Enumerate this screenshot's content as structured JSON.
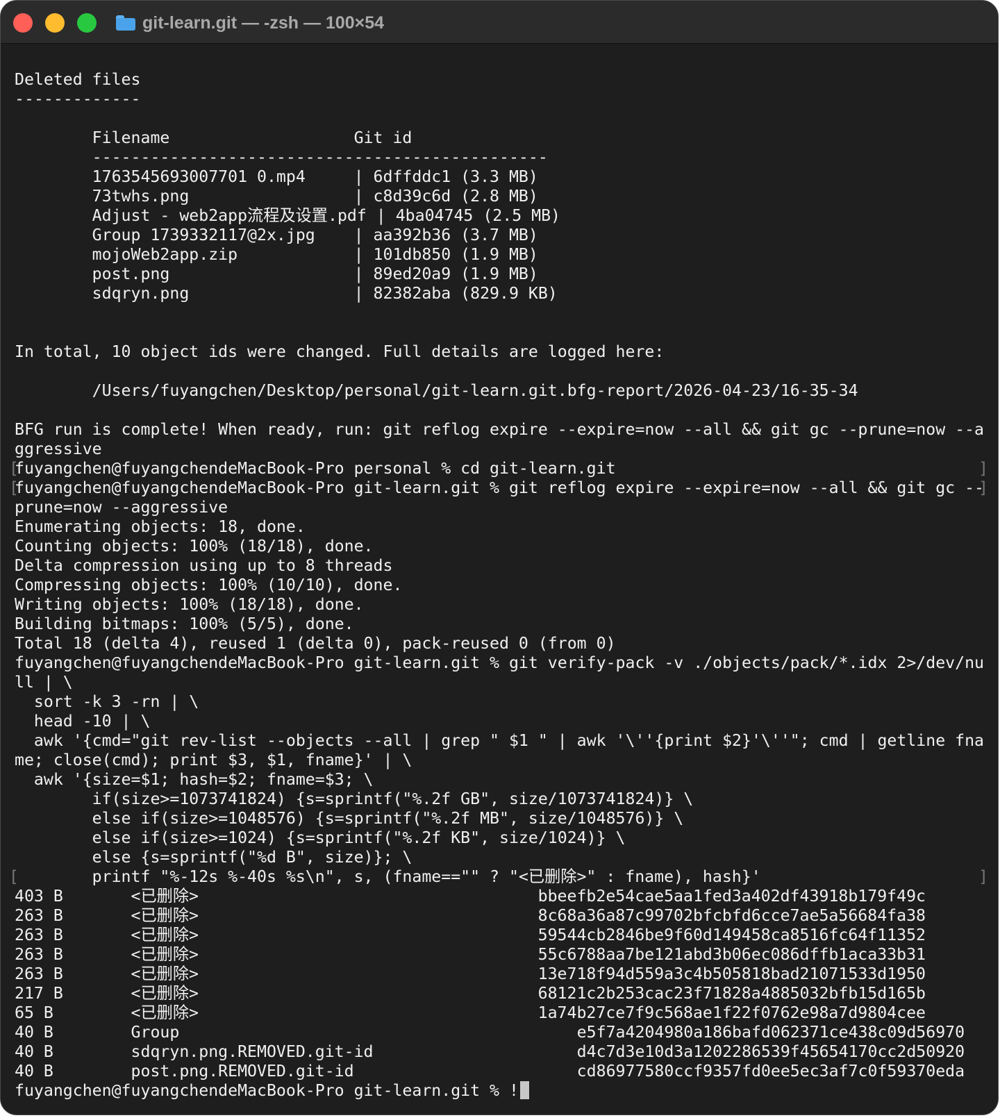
{
  "window": {
    "title": "git-learn.git — -zsh — 100×54",
    "folder_icon": "folder-icon",
    "colors": {
      "close": "#ff5f57",
      "minimize": "#febc2e",
      "maximize": "#28c840",
      "background": "#1e1e1e",
      "text": "#f0f0f0"
    }
  },
  "terminal": {
    "lines": [
      {
        "text": "Deleted files"
      },
      {
        "text": "-------------"
      },
      {
        "text": ""
      },
      {
        "text": "        Filename                   Git id"
      },
      {
        "text": "        -----------------------------------------------"
      },
      {
        "text": "        1763545693007701 0.mp4     | 6dffddc1 (3.3 MB)"
      },
      {
        "text": "        73twhs.png                 | c8d39c6d (2.8 MB)"
      },
      {
        "text": "        Adjust - web2app流程及设置.pdf | 4ba04745 (2.5 MB)"
      },
      {
        "text": "        Group 1739332117@2x.jpg    | aa392b36 (3.7 MB)"
      },
      {
        "text": "        mojoWeb2app.zip            | 101db850 (1.9 MB)"
      },
      {
        "text": "        post.png                   | 89ed20a9 (1.9 MB)"
      },
      {
        "text": "        sdqryn.png                 | 82382aba (829.9 KB)"
      },
      {
        "text": ""
      },
      {
        "text": ""
      },
      {
        "text": "In total, 10 object ids were changed. Full details are logged here:"
      },
      {
        "text": ""
      },
      {
        "text": "        /Users/fuyangchen/Desktop/personal/git-learn.git.bfg-report/2026-04-23/16-35-34"
      },
      {
        "text": ""
      },
      {
        "text": "BFG run is complete! When ready, run: git reflog expire --expire=now --all && git gc --prune=now --a"
      },
      {
        "text": "ggressive"
      },
      {
        "text": "fuyangchen@fuyangchendeMacBook-Pro personal % cd git-learn.git",
        "bracket": true
      },
      {
        "text": "fuyangchen@fuyangchendeMacBook-Pro git-learn.git % git reflog expire --expire=now --all && git gc --",
        "bracket": true
      },
      {
        "text": "prune=now --aggressive"
      },
      {
        "text": "Enumerating objects: 18, done."
      },
      {
        "text": "Counting objects: 100% (18/18), done."
      },
      {
        "text": "Delta compression using up to 8 threads"
      },
      {
        "text": "Compressing objects: 100% (10/10), done."
      },
      {
        "text": "Writing objects: 100% (18/18), done."
      },
      {
        "text": "Building bitmaps: 100% (5/5), done."
      },
      {
        "text": "Total 18 (delta 4), reused 1 (delta 0), pack-reused 0 (from 0)"
      },
      {
        "text": "fuyangchen@fuyangchendeMacBook-Pro git-learn.git % git verify-pack -v ./objects/pack/*.idx 2>/dev/nu"
      },
      {
        "text": "ll | \\"
      },
      {
        "text": "  sort -k 3 -rn | \\"
      },
      {
        "text": "  head -10 | \\"
      },
      {
        "text": "  awk '{cmd=\"git rev-list --objects --all | grep \" $1 \" | awk '\\''{print $2}'\\''\"; cmd | getline fna"
      },
      {
        "text": "me; close(cmd); print $3, $1, fname}' | \\"
      },
      {
        "text": "  awk '{size=$1; hash=$2; fname=$3; \\"
      },
      {
        "text": "        if(size>=1073741824) {s=sprintf(\"%.2f GB\", size/1073741824)} \\"
      },
      {
        "text": "        else if(size>=1048576) {s=sprintf(\"%.2f MB\", size/1048576)} \\"
      },
      {
        "text": "        else if(size>=1024) {s=sprintf(\"%.2f KB\", size/1024)} \\"
      },
      {
        "text": "        else {s=sprintf(\"%d B\", size)}; \\"
      },
      {
        "text": "        printf \"%-12s %-40s %s\\n\", s, (fname==\"\" ? \"<已删除>\" : fname), hash}'",
        "bracket": true
      },
      {
        "text": "403 B       <已删除>                                   bbeefb2e54cae5aa1fed3a402df43918b179f49c"
      },
      {
        "text": "263 B       <已删除>                                   8c68a36a87c99702bfcbfd6cce7ae5a56684fa38"
      },
      {
        "text": "263 B       <已删除>                                   59544cb2846be9f60d149458ca8516fc64f11352"
      },
      {
        "text": "263 B       <已删除>                                   55c6788aa7be121abd3b06ec086dffb1aca33b31"
      },
      {
        "text": "263 B       <已删除>                                   13e718f94d559a3c4b505818bad21071533d1950"
      },
      {
        "text": "217 B       <已删除>                                   68121c2b253cac23f71828a4885032bfb15d165b"
      },
      {
        "text": "65 B        <已删除>                                   1a74b27ce7f9c568ae1f22f0762e98a7d9804cee"
      },
      {
        "text": "40 B        Group                                         e5f7a4204980a186bafd062371ce438c09d56970"
      },
      {
        "text": "40 B        sdqryn.png.REMOVED.git-id                     d4c7d3e10d3a1202286539f45654170cc2d50920"
      },
      {
        "text": "40 B        post.png.REMOVED.git-id                       cd86977580ccf9357fd0ee5ec3af7c0f59370eda"
      }
    ],
    "prompt": "fuyangchen@fuyangchendeMacBook-Pro git-learn.git % !"
  }
}
